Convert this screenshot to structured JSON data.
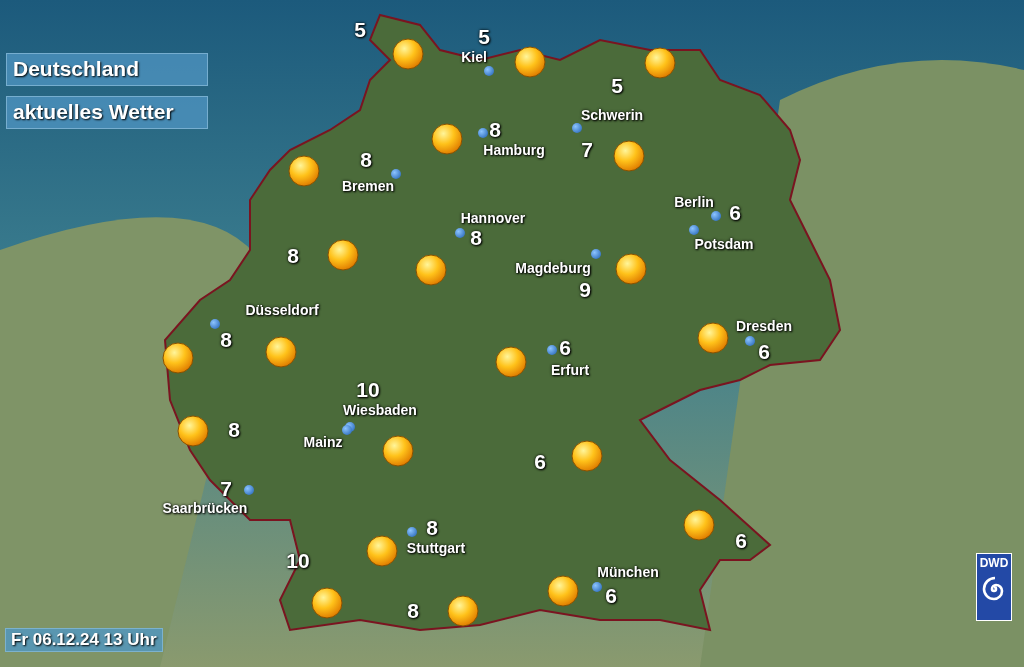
{
  "header": {
    "title": "Deutschland",
    "subtitle": "aktuelles Wetter"
  },
  "weather_symbols": [
    {
      "kind": "sun"
    },
    {
      "kind": "sun"
    },
    {
      "kind": "sun"
    },
    {
      "kind": "sun"
    },
    {
      "kind": "sun"
    },
    {
      "kind": "sun"
    },
    {
      "kind": "sun"
    },
    {
      "kind": "sun"
    },
    {
      "kind": "sun"
    },
    {
      "kind": "sun"
    },
    {
      "kind": "sun"
    },
    {
      "kind": "sun"
    },
    {
      "kind": "sun"
    },
    {
      "kind": "sun"
    },
    {
      "kind": "sun"
    },
    {
      "kind": "sun"
    },
    {
      "kind": "sun"
    },
    {
      "kind": "sun"
    },
    {
      "kind": "sun"
    },
    {
      "kind": "sun"
    },
    {
      "kind": "sun"
    }
  ],
  "temperatures": [
    "5",
    "5",
    "5",
    "8",
    "7",
    "8",
    "6",
    "8",
    "8",
    "9",
    "8",
    "6",
    "6",
    "10",
    "8",
    "6",
    "7",
    "8",
    "6",
    "10",
    "6",
    "8"
  ],
  "cities": [
    "Kiel",
    "Schwerin",
    "Hamburg",
    "Bremen",
    "Hannover",
    "Berlin",
    "Potsdam",
    "Magdeburg",
    "Düsseldorf",
    "Erfurt",
    "Dresden",
    "Wiesbaden",
    "Mainz",
    "Saarbrücken",
    "Stuttgart",
    "München"
  ],
  "logo": "DWD",
  "timestamp": "Fr 06.12.24 13 Uhr"
}
